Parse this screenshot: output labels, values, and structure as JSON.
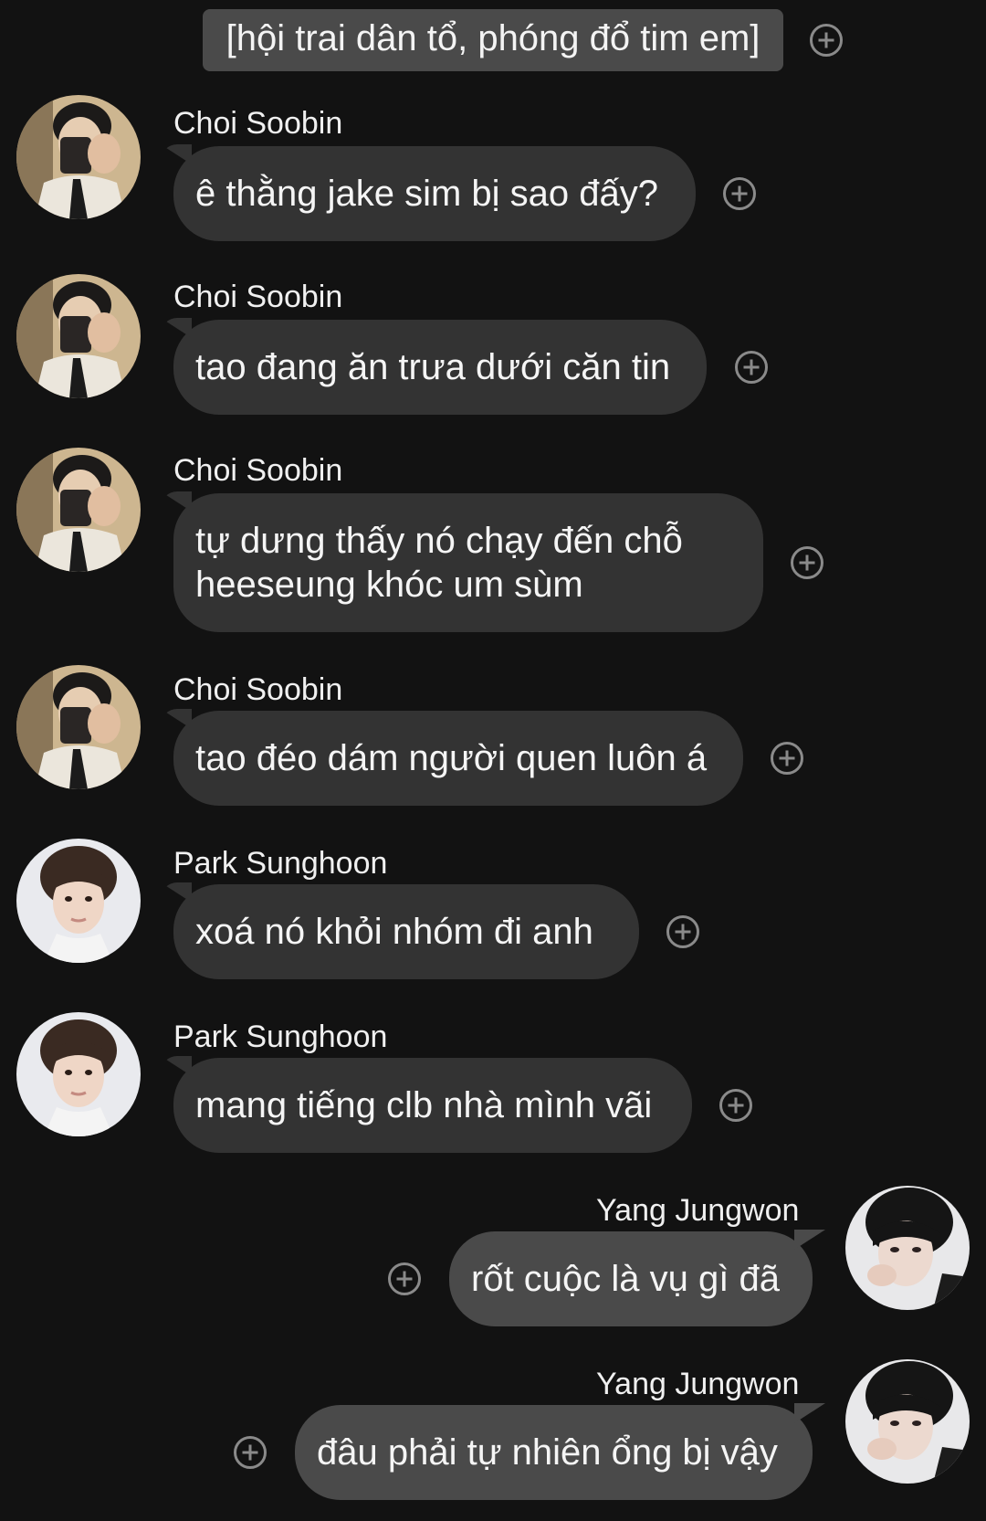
{
  "group_title": "[hội trai dân tổ, phóng đổ tim em]",
  "messages": [
    {
      "sender": "Choi Soobin",
      "text": "ê thằng jake sim bị sao đấy?"
    },
    {
      "sender": "Choi Soobin",
      "text": "tao đang ăn trưa dưới căn tin"
    },
    {
      "sender": "Choi Soobin",
      "text": "tự dưng thấy nó chạy đến chỗ heeseung khóc um sùm"
    },
    {
      "sender": "Choi Soobin",
      "text": "tao đéo dám người quen luôn á"
    },
    {
      "sender": "Park Sunghoon",
      "text": "xoá nó khỏi nhóm đi anh"
    },
    {
      "sender": "Park Sunghoon",
      "text": "mang tiếng clb nhà mình vãi"
    },
    {
      "sender": "Yang Jungwon",
      "text": "rốt cuộc là vụ gì đã"
    },
    {
      "sender": "Yang Jungwon",
      "text": "đâu phải tự nhiên ổng bị vậy"
    }
  ],
  "colors": {
    "background": "#121212",
    "bubble_incoming": "#333333",
    "bubble_outgoing": "#4a4a4a",
    "add_reaction_icon": "#8a8a8a"
  },
  "icons": {
    "add_reaction": "plus-circle-icon"
  }
}
